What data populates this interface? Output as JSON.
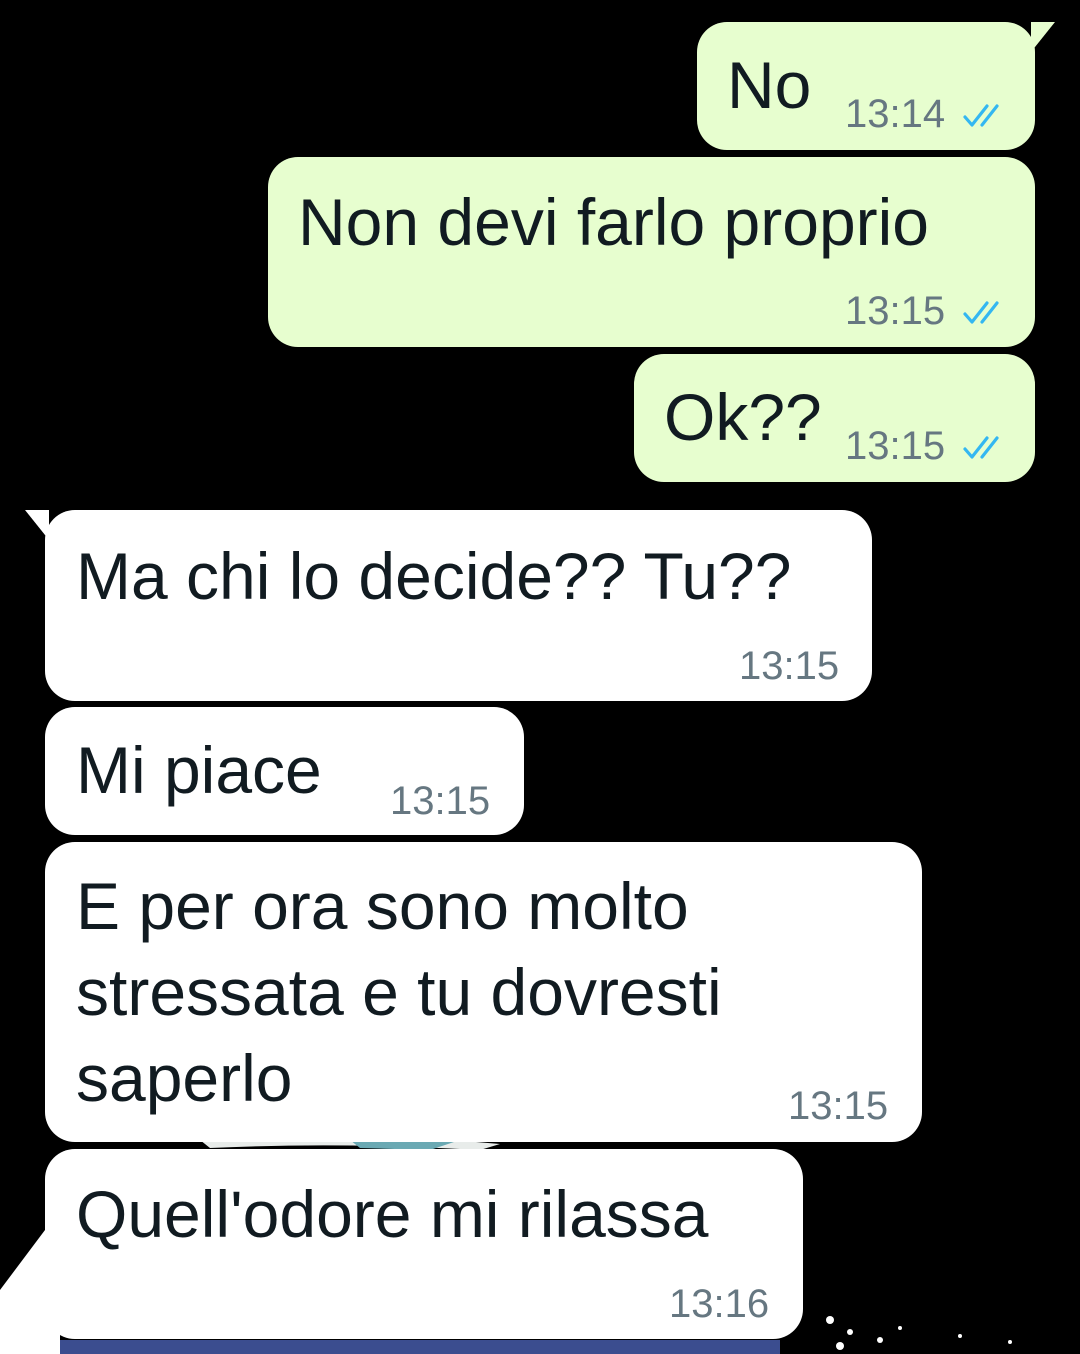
{
  "colors": {
    "background": "#000000",
    "outgoing_bubble": "#e7fecf",
    "incoming_bubble": "#ffffff",
    "text": "#111b21",
    "timestamp": "#667781",
    "read_tick": "#34b7f1"
  },
  "messages": [
    {
      "direction": "out",
      "text": "No",
      "time": "13:14",
      "status": "read"
    },
    {
      "direction": "out",
      "text": "Non devi farlo proprio",
      "time": "13:15",
      "status": "read"
    },
    {
      "direction": "out",
      "text": "Ok??",
      "time": "13:15",
      "status": "read"
    },
    {
      "direction": "in",
      "text": "Ma chi lo decide?? Tu??",
      "time": "13:15"
    },
    {
      "direction": "in",
      "text": "Mi piace",
      "time": "13:15"
    },
    {
      "direction": "in",
      "lines": [
        "E per ora sono molto",
        "stressata e tu dovresti",
        "saperlo"
      ],
      "time": "13:15"
    },
    {
      "direction": "in",
      "text": "Quell'odore mi rilassa",
      "time": "13:16"
    }
  ],
  "icons": {
    "read_receipt": "double-check-icon"
  }
}
